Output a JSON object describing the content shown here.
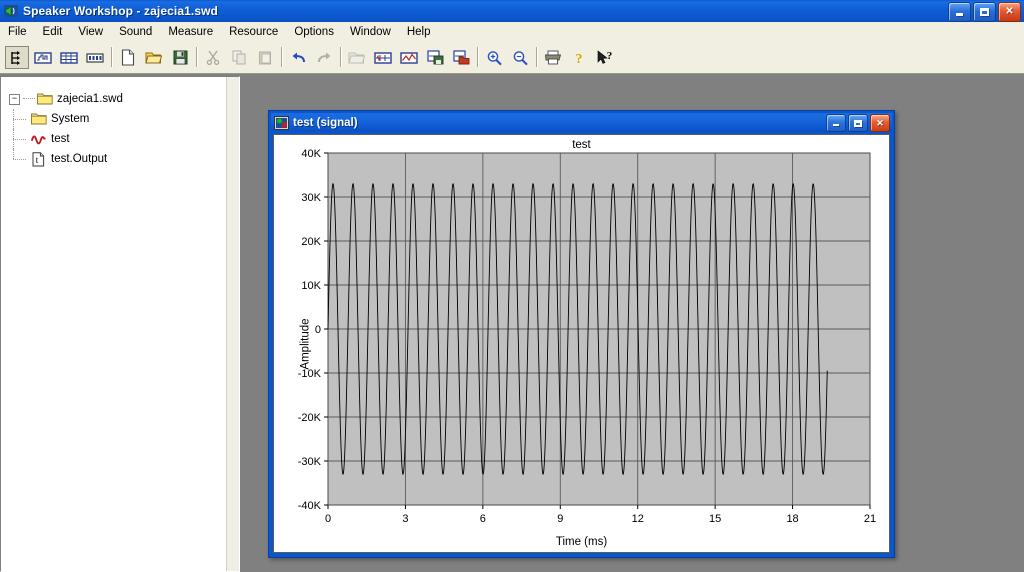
{
  "window": {
    "title": "Speaker Workshop - zajecia1.swd",
    "icon": "speaker-icon",
    "buttons": [
      {
        "name": "minimize-button",
        "glyph": "minimize"
      },
      {
        "name": "maximize-button",
        "glyph": "maximize"
      },
      {
        "name": "close-button",
        "glyph": "✕"
      }
    ]
  },
  "menubar": {
    "items": [
      "File",
      "Edit",
      "View",
      "Sound",
      "Measure",
      "Resource",
      "Options",
      "Window",
      "Help"
    ]
  },
  "toolbar": {
    "buttons": [
      {
        "name": "signal-generator-button",
        "icon": "signal-tool-icon",
        "state": "pressed"
      },
      {
        "name": "spectrum-view-button",
        "icon": "spectrum-panel-icon",
        "state": "normal"
      },
      {
        "name": "data-grid-button",
        "icon": "data-grid-icon",
        "state": "normal"
      },
      {
        "name": "meter-button",
        "icon": "meter-icon",
        "state": "normal"
      },
      {
        "name": "separator-1",
        "icon": "separator",
        "state": "separator"
      },
      {
        "name": "new-button",
        "icon": "new-document-icon",
        "state": "normal"
      },
      {
        "name": "open-button",
        "icon": "open-folder-icon",
        "state": "normal"
      },
      {
        "name": "save-button",
        "icon": "floppy-disk-icon",
        "state": "normal"
      },
      {
        "name": "separator-2",
        "icon": "separator",
        "state": "separator"
      },
      {
        "name": "cut-button",
        "icon": "scissors-icon",
        "state": "disabled"
      },
      {
        "name": "copy-button",
        "icon": "copy-icon",
        "state": "disabled"
      },
      {
        "name": "paste-button",
        "icon": "paste-icon",
        "state": "disabled"
      },
      {
        "name": "separator-3",
        "icon": "separator",
        "state": "separator"
      },
      {
        "name": "undo-button",
        "icon": "undo-arrow-icon",
        "state": "normal"
      },
      {
        "name": "redo-button",
        "icon": "redo-arrow-icon",
        "state": "disabled"
      },
      {
        "name": "separator-4",
        "icon": "separator",
        "state": "separator"
      },
      {
        "name": "import-button",
        "icon": "import-folder-icon",
        "state": "disabled"
      },
      {
        "name": "signal-window-button",
        "icon": "signal-window-icon",
        "state": "normal"
      },
      {
        "name": "chart-window-button",
        "icon": "chart-window-icon",
        "state": "normal"
      },
      {
        "name": "save-signal-button",
        "icon": "save-signal-icon",
        "state": "normal"
      },
      {
        "name": "open-signal-button",
        "icon": "open-signal-icon",
        "state": "normal"
      },
      {
        "name": "separator-5",
        "icon": "separator",
        "state": "separator"
      },
      {
        "name": "zoom-in-button",
        "icon": "zoom-in-icon",
        "state": "normal"
      },
      {
        "name": "zoom-out-button",
        "icon": "zoom-out-icon",
        "state": "normal"
      },
      {
        "name": "separator-6",
        "icon": "separator",
        "state": "separator"
      },
      {
        "name": "print-button",
        "icon": "printer-icon",
        "state": "normal"
      },
      {
        "name": "help-button",
        "icon": "question-mark-icon",
        "state": "normal"
      },
      {
        "name": "context-help-button",
        "icon": "arrow-question-icon",
        "state": "normal"
      }
    ]
  },
  "tree": {
    "nodes": [
      {
        "label": "zajecia1.swd",
        "icon": "folder-icon",
        "level": 0,
        "expanded": true,
        "name": "tree-node-project"
      },
      {
        "label": "System",
        "icon": "folder-icon",
        "level": 1,
        "expanded": false,
        "name": "tree-node-system"
      },
      {
        "label": "test",
        "icon": "waveform-icon",
        "level": 1,
        "expanded": false,
        "name": "tree-node-test"
      },
      {
        "label": "test.Output",
        "icon": "text-document-icon",
        "level": 1,
        "expanded": false,
        "name": "tree-node-test-output"
      }
    ]
  },
  "child_window": {
    "title": "test (signal)",
    "icon": "signal-document-icon",
    "buttons": [
      {
        "name": "child-minimize-button",
        "glyph": "minimize"
      },
      {
        "name": "child-maximize-button",
        "glyph": "maximize"
      },
      {
        "name": "child-close-button",
        "glyph": "✕"
      }
    ]
  },
  "chart_data": {
    "type": "line",
    "title": "test",
    "xlabel": "Time (ms)",
    "ylabel": "Amplitude",
    "xlim": [
      0,
      21
    ],
    "ylim": [
      -40000,
      40000
    ],
    "xticks": [
      0,
      3,
      6,
      9,
      12,
      15,
      18,
      21
    ],
    "xtick_labels": [
      "0",
      "3",
      "6",
      "9",
      "12",
      "15",
      "18",
      "21"
    ],
    "yticks": [
      -40000,
      -30000,
      -20000,
      -10000,
      0,
      10000,
      20000,
      30000,
      40000
    ],
    "ytick_labels": [
      "-40K",
      "-30K",
      "-20K",
      "-10K",
      "0",
      "10K",
      "20K",
      "30K",
      "40K"
    ],
    "grid": true,
    "legend": false,
    "plot_bg": "#c0c0c0",
    "line_color": "#000000",
    "series": [
      {
        "name": "test",
        "waveform": "sine",
        "amplitude": 33000,
        "frequency_khz": 1.29,
        "phase": 0,
        "t_start": 0,
        "t_end": 19.35,
        "sample_step": 0.012,
        "description": "1.29 kHz sine tone, peak amplitude approx. 33K, 25 full cycles from 0 to 19.35 ms"
      }
    ]
  }
}
